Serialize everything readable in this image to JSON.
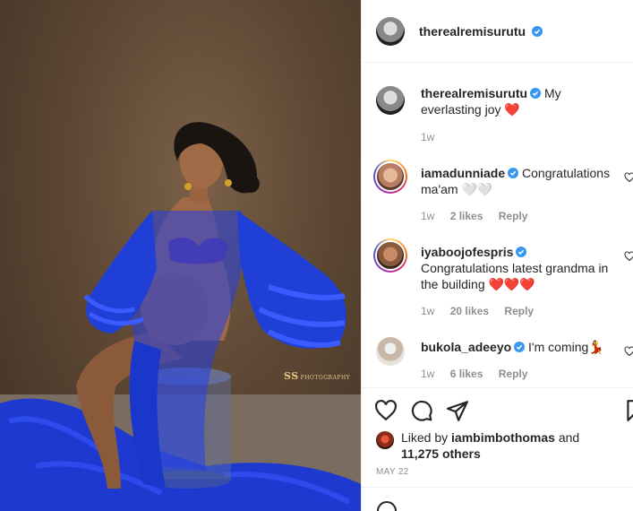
{
  "post": {
    "author": "therealremisurutu",
    "caption_text": "My everlasting joy",
    "caption_emoji": "❤️",
    "caption_time": "1w",
    "watermark": "PHOTOGRAPHY",
    "watermark_mark": "SS",
    "liked_by_prefix": "Liked by ",
    "liked_by_user": "iambimbothomas",
    "liked_by_middle": " and",
    "likes_count": "11,275 others",
    "date": "MAY 22"
  },
  "comments": [
    {
      "user": "iamadunniade",
      "text": "Congratulations ma'am 🤍🤍",
      "time": "1w",
      "likes": "2 likes",
      "reply": "Reply"
    },
    {
      "user": "iyaboojofespris",
      "text": "Congratulations latest grandma in the building ❤️❤️❤️",
      "time": "1w",
      "likes": "20 likes",
      "reply": "Reply"
    },
    {
      "user": "bukola_adeeyo",
      "text": "I'm coming💃",
      "time": "1w",
      "likes": "6 likes",
      "reply": "Reply"
    }
  ],
  "icons": {
    "like": "heart-icon",
    "comment": "comment-icon",
    "share": "paper-plane-icon",
    "save": "bookmark-icon",
    "verified": "verified-badge-icon"
  },
  "colors": {
    "verified": "#3897f0",
    "link": "#262626",
    "muted": "#8e8e8e",
    "heart": "#ed4956",
    "dress": "#1f3fd6"
  }
}
